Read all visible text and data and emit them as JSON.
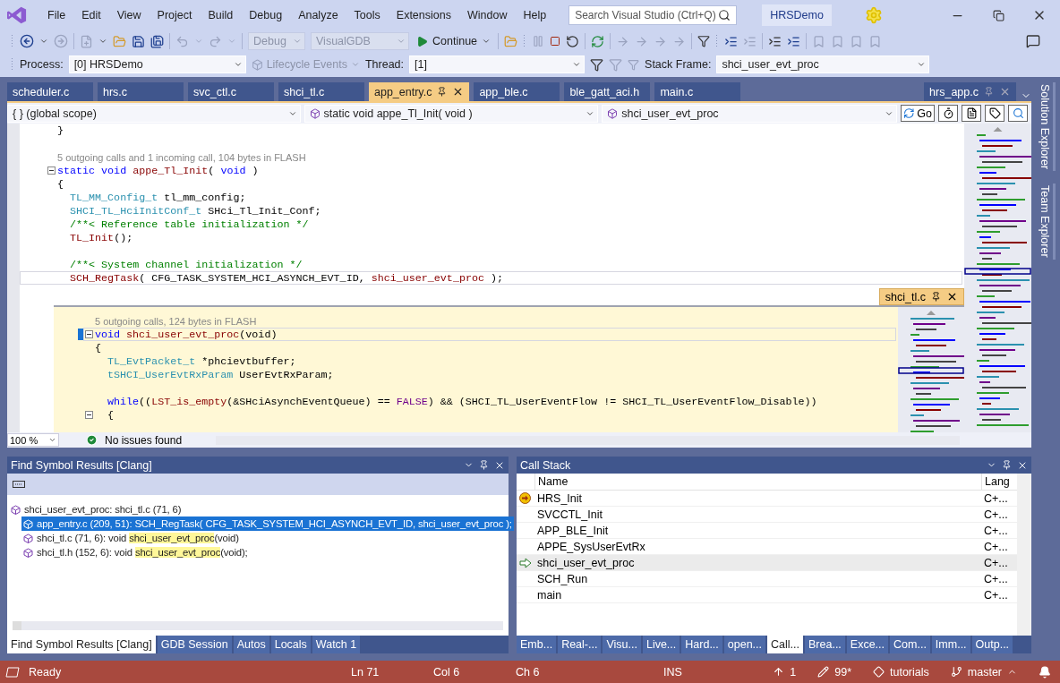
{
  "menu": [
    "File",
    "Edit",
    "View",
    "Project",
    "Build",
    "Debug",
    "Analyze",
    "Tools",
    "Extensions",
    "Window",
    "Help"
  ],
  "search": {
    "placeholder": "Search Visual Studio (Ctrl+Q)"
  },
  "solution_name": "HRSDemo",
  "toolbar": {
    "configuration": {
      "value": "Debug",
      "disabled": true
    },
    "platform": {
      "value": "VisualGDB",
      "disabled": true
    },
    "continue": "Continue"
  },
  "debug_location": {
    "process_label": "Process:",
    "process": "[0] HRSDemo",
    "lifecycle": {
      "label": "Lifecycle Events",
      "disabled": true
    },
    "thread_label": "Thread:",
    "thread": "[1]",
    "stack_frame_label": "Stack Frame:",
    "stack_frame": "shci_user_evt_proc"
  },
  "tabs": [
    {
      "label": "scheduler.c",
      "selected": false
    },
    {
      "label": "hrs.c",
      "selected": false
    },
    {
      "label": "svc_ctl.c",
      "selected": false
    },
    {
      "label": "shci_tl.c",
      "selected": false
    },
    {
      "label": "app_entry.c",
      "selected": true
    },
    {
      "label": "app_ble.c",
      "selected": false
    },
    {
      "label": "ble_gatt_aci.h",
      "selected": false
    },
    {
      "label": "main.c",
      "selected": false
    }
  ],
  "preview_tab": {
    "label": "hrs_app.c"
  },
  "navigation": {
    "scope": "{ } (global scope)",
    "function": "static void appe_Tl_Init( void )",
    "member": "shci_user_evt_proc",
    "go": "Go"
  },
  "editor": {
    "lines": [
      {
        "kind": "code",
        "fold": false,
        "current": false,
        "segments": [
          {
            "kind": "plain",
            "text": "}"
          }
        ]
      },
      {
        "kind": "blank"
      },
      {
        "kind": "lens",
        "fold": false,
        "current": false,
        "text": "5 outgoing calls and 1 incoming call, 104 bytes in FLASH"
      },
      {
        "kind": "code",
        "fold": true,
        "current": false,
        "segments": [
          {
            "kind": "kw",
            "text": "static void"
          },
          {
            "kind": "fn",
            "text": " appe_Tl_Init"
          },
          {
            "kind": "plain",
            "text": "( "
          },
          {
            "kind": "kw",
            "text": "void"
          },
          {
            "kind": "plain",
            "text": " )"
          }
        ]
      },
      {
        "kind": "code",
        "fold": false,
        "current": false,
        "segments": [
          {
            "kind": "plain",
            "text": "{"
          }
        ]
      },
      {
        "kind": "code",
        "fold": false,
        "current": false,
        "segments": [
          {
            "kind": "type",
            "text": "  TL_MM_Config_t"
          },
          {
            "kind": "plain",
            "text": " tl_mm_config;"
          }
        ]
      },
      {
        "kind": "code",
        "fold": false,
        "current": false,
        "segments": [
          {
            "kind": "type",
            "text": "  SHCI_TL_HciInitConf_t"
          },
          {
            "kind": "plain",
            "text": " SHci_Tl_Init_Conf;"
          }
        ]
      },
      {
        "kind": "code",
        "fold": false,
        "current": false,
        "segments": [
          {
            "kind": "comment",
            "text": "  /**< Reference table initialization */"
          }
        ]
      },
      {
        "kind": "code",
        "fold": false,
        "current": false,
        "segments": [
          {
            "kind": "fn",
            "text": "  TL_Init"
          },
          {
            "kind": "plain",
            "text": "();"
          }
        ]
      },
      {
        "kind": "blank"
      },
      {
        "kind": "code",
        "fold": false,
        "current": false,
        "segments": [
          {
            "kind": "comment",
            "text": "  /**< System channel initialization */"
          }
        ]
      },
      {
        "kind": "code",
        "fold": false,
        "current": true,
        "segments": [
          {
            "kind": "fn",
            "text": "  SCH_RegTask"
          },
          {
            "kind": "plain",
            "text": "( CFG_TASK_SYSTEM_HCI_ASYNCH_EVT_ID, "
          },
          {
            "kind": "fn",
            "text": "shci_user_evt_proc"
          },
          {
            "kind": "plain",
            "text": " );"
          }
        ]
      }
    ]
  },
  "peek": {
    "tab": "shci_tl.c",
    "lines": [
      {
        "kind": "lens",
        "fold": false,
        "current": false,
        "text": "5 outgoing calls, 124 bytes in FLASH"
      },
      {
        "kind": "code",
        "fold": true,
        "current": true,
        "segments": [
          {
            "kind": "kw",
            "text": "void"
          },
          {
            "kind": "fn",
            "text": " shci_user_evt_proc"
          },
          {
            "kind": "plain",
            "text": "(void)"
          }
        ]
      },
      {
        "kind": "code",
        "fold": false,
        "current": false,
        "segments": [
          {
            "kind": "plain",
            "text": "{"
          }
        ]
      },
      {
        "kind": "code",
        "fold": false,
        "current": false,
        "segments": [
          {
            "kind": "type",
            "text": "  TL_EvtPacket_t"
          },
          {
            "kind": "plain",
            "text": " *phcievtbuffer;"
          }
        ]
      },
      {
        "kind": "code",
        "fold": false,
        "current": false,
        "segments": [
          {
            "kind": "type",
            "text": "  tSHCI_UserEvtRxParam"
          },
          {
            "kind": "plain",
            "text": " UserEvtRxParam;"
          }
        ]
      },
      {
        "kind": "blank"
      },
      {
        "kind": "code",
        "fold": false,
        "current": false,
        "segments": [
          {
            "kind": "kw",
            "text": "  while"
          },
          {
            "kind": "plain",
            "text": "(("
          },
          {
            "kind": "fn",
            "text": "LST_is_empty"
          },
          {
            "kind": "plain",
            "text": "(&SHciAsynchEventQueue) == "
          },
          {
            "kind": "macro",
            "text": "FALSE"
          },
          {
            "kind": "plain",
            "text": ") && (SHCI_TL_UserEventFlow != SHCI_TL_UserEventFlow_Disable))"
          }
        ]
      },
      {
        "kind": "code",
        "fold": true,
        "current": false,
        "segments": [
          {
            "kind": "plain",
            "text": "  {"
          }
        ]
      }
    ]
  },
  "editor_status": {
    "zoom": "100 %",
    "issues": "No issues found"
  },
  "find_panel": {
    "title": "Find Symbol Results [Clang]",
    "results": [
      {
        "prefix": "shci_user_evt_proc: shci_tl.c (71, 6)",
        "selected": false,
        "children": [
          {
            "prefix": "app_entry.c (209, 51): SCH_RegTask( CFG_TASK_SYSTEM_HCI_ASYNCH_EVT_ID, shci_user_evt_proc );",
            "selected": true
          },
          {
            "prefix": "shci_tl.c (71, 6): void ",
            "match": "shci_user_evt_proc",
            "suffix": "(void)",
            "selected": false
          },
          {
            "prefix": "shci_tl.h (152, 6): void ",
            "match": "shci_user_evt_proc",
            "suffix": "(void);",
            "selected": false
          }
        ]
      }
    ],
    "tabs": [
      {
        "label": "Find Symbol Results [Clang]",
        "selected": true
      },
      {
        "label": "GDB Session",
        "selected": false
      },
      {
        "label": "Autos",
        "selected": false
      },
      {
        "label": "Locals",
        "selected": false
      },
      {
        "label": "Watch 1",
        "selected": false
      }
    ]
  },
  "call_stack": {
    "title": "Call Stack",
    "columns": [
      "Name",
      "Lang"
    ],
    "rows": [
      {
        "name": "HRS_Init",
        "lang": "C+...",
        "kind": "current",
        "selected": false
      },
      {
        "name": "SVCCTL_Init",
        "lang": "C+...",
        "kind": "plain",
        "selected": false
      },
      {
        "name": "APP_BLE_Init",
        "lang": "C+...",
        "kind": "plain",
        "selected": false
      },
      {
        "name": "APPE_SysUserEvtRx",
        "lang": "C+...",
        "kind": "plain",
        "selected": false
      },
      {
        "name": "shci_user_evt_proc",
        "lang": "C+...",
        "kind": "caller",
        "selected": true
      },
      {
        "name": "SCH_Run",
        "lang": "C+...",
        "kind": "plain",
        "selected": false
      },
      {
        "name": "main",
        "lang": "C+...",
        "kind": "plain",
        "selected": false
      }
    ],
    "tabs": [
      {
        "label": "Emb...",
        "selected": false
      },
      {
        "label": "Real-...",
        "selected": false
      },
      {
        "label": "Visu...",
        "selected": false
      },
      {
        "label": "Live...",
        "selected": false
      },
      {
        "label": "Hard...",
        "selected": false
      },
      {
        "label": "open...",
        "selected": false
      },
      {
        "label": "Call...",
        "selected": true
      },
      {
        "label": "Brea...",
        "selected": false
      },
      {
        "label": "Exce...",
        "selected": false
      },
      {
        "label": "Com...",
        "selected": false
      },
      {
        "label": "Imm...",
        "selected": false
      },
      {
        "label": "Outp...",
        "selected": false
      }
    ]
  },
  "side_panels": [
    "Solution Explorer",
    "Team Explorer"
  ],
  "status_bar": {
    "message": "Ready",
    "position": [
      "Ln 71",
      "Col 6",
      "Ch 6"
    ],
    "mode": "INS",
    "git": [
      {
        "kind": "push",
        "text": "1"
      },
      {
        "kind": "changes",
        "text": "99*"
      },
      {
        "kind": "repo",
        "text": "tutorials"
      },
      {
        "kind": "branch",
        "text": "master"
      }
    ]
  }
}
